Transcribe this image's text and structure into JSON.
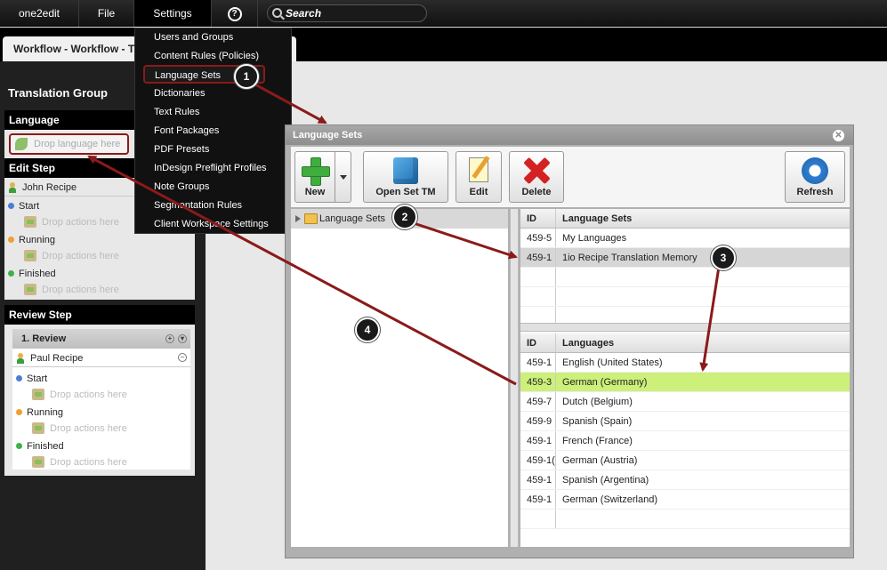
{
  "menubar": {
    "app": "one2edit",
    "file": "File",
    "settings": "Settings",
    "help": "?",
    "search_placeholder": "Search"
  },
  "tab": {
    "title": "Workflow - Workflow - T"
  },
  "left_panel": {
    "title": "Translation Group",
    "language_header": "Language",
    "drop_language": "Drop language here",
    "edit_step_header": "Edit Step",
    "edit_user": "John Recipe",
    "states": [
      "Start",
      "Running",
      "Finished"
    ],
    "drop_actions": "Drop actions here",
    "review_step_header": "Review Step",
    "review_title": "1. Review",
    "review_user": "Paul Recipe"
  },
  "settings_menu": {
    "items": [
      "Users and Groups",
      "Content Rules (Policies)",
      "Language Sets",
      "Dictionaries",
      "Text Rules",
      "Font Packages",
      "PDF Presets",
      "InDesign Preflight Profiles",
      "Note Groups",
      "Segmentation Rules",
      "Client Workspace Settings"
    ]
  },
  "dialog": {
    "title": "Language Sets",
    "toolbar": {
      "new": "New",
      "open_set_tm": "Open Set TM",
      "edit": "Edit",
      "delete": "Delete",
      "refresh": "Refresh"
    },
    "tree_root": "Language Sets",
    "sets_grid": {
      "headers": [
        "ID",
        "Language Sets"
      ],
      "rows": [
        {
          "id": "459-5",
          "name": "My Languages"
        },
        {
          "id": "459-1",
          "name": "1io Recipe Translation Memory"
        }
      ]
    },
    "languages_grid": {
      "headers": [
        "ID",
        "Languages"
      ],
      "rows": [
        {
          "id": "459-1",
          "name": "English (United States)"
        },
        {
          "id": "459-3",
          "name": "German (Germany)"
        },
        {
          "id": "459-7",
          "name": "Dutch (Belgium)"
        },
        {
          "id": "459-9",
          "name": "Spanish (Spain)"
        },
        {
          "id": "459-1",
          "name": "French (France)"
        },
        {
          "id": "459-1(",
          "name": "German (Austria)"
        },
        {
          "id": "459-1",
          "name": "Spanish (Argentina)"
        },
        {
          "id": "459-1",
          "name": "German (Switzerland)"
        }
      ]
    }
  },
  "callouts": [
    "1",
    "2",
    "3",
    "4"
  ],
  "colors": {
    "highlight_row": "#ccf07a",
    "callout_outline": "#8b1a1a",
    "arrow": "#8b1a1a"
  }
}
